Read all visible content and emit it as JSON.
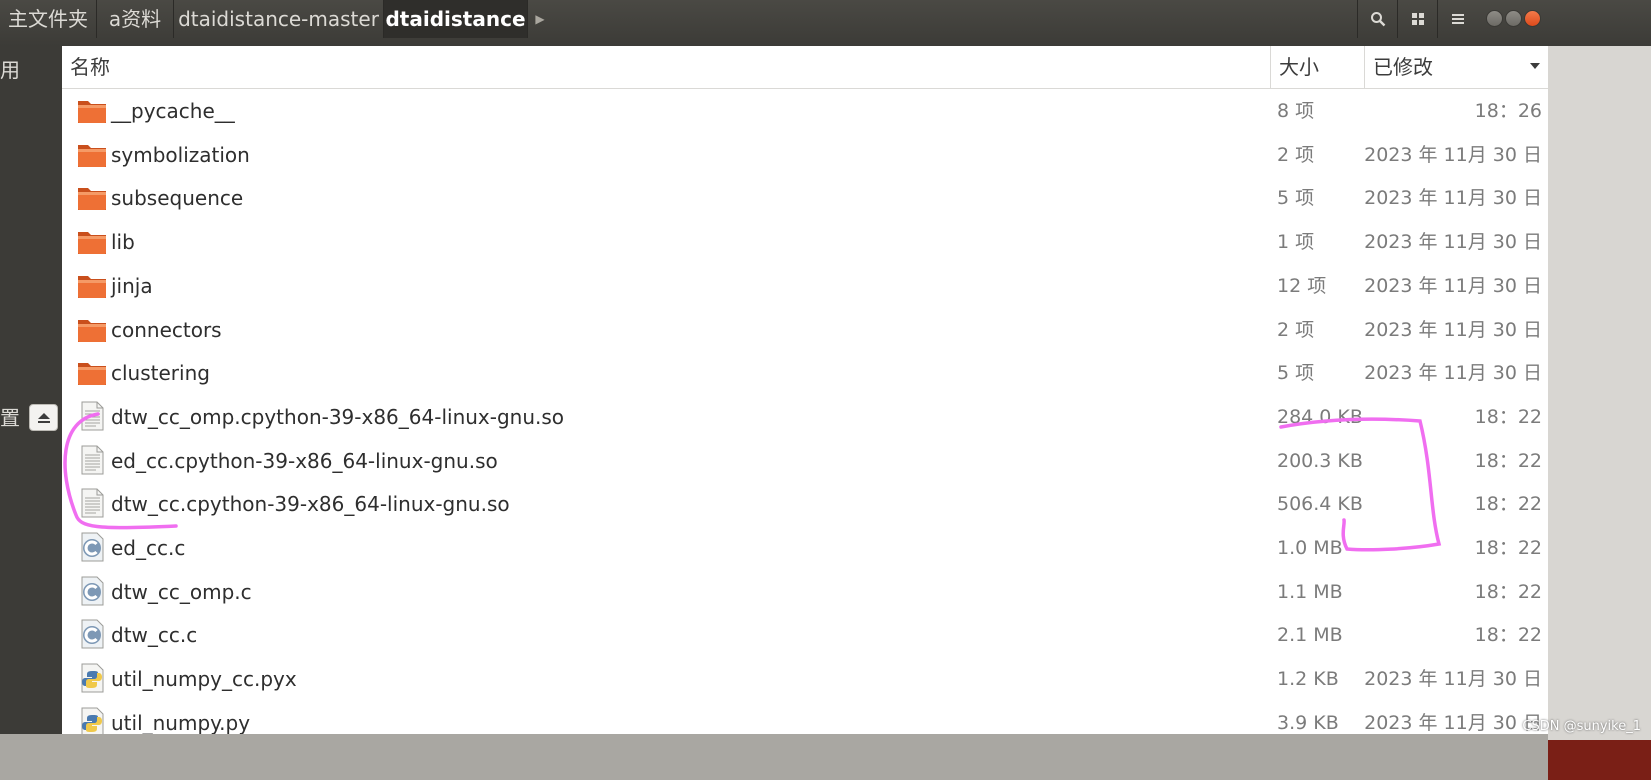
{
  "breadcrumbs": [
    "主文件夹",
    "a资料",
    "dtaidistance-master",
    "dtaidistance"
  ],
  "toolbar": {
    "search_icon": "search-icon",
    "view_icon": "grid-view-icon",
    "menu_icon": "hamburger-menu-icon"
  },
  "sidebar": {
    "partial_label_1": "用",
    "partial_label_2": "置",
    "eject_icon": "eject-icon"
  },
  "columns": {
    "name": "名称",
    "size": "大小",
    "modified": "已修改",
    "sort_icon": "sort-descending-icon"
  },
  "files": [
    {
      "name": "__pycache__",
      "size": "8 项",
      "modified": "18：26",
      "type": "folder"
    },
    {
      "name": "symbolization",
      "size": "2 项",
      "modified": "2023 年 11月 30 日",
      "type": "folder"
    },
    {
      "name": "subsequence",
      "size": "5 项",
      "modified": "2023 年 11月 30 日",
      "type": "folder"
    },
    {
      "name": "lib",
      "size": "1 项",
      "modified": "2023 年 11月 30 日",
      "type": "folder"
    },
    {
      "name": "jinja",
      "size": "12 项",
      "modified": "2023 年 11月 30 日",
      "type": "folder"
    },
    {
      "name": "connectors",
      "size": "2 项",
      "modified": "2023 年 11月 30 日",
      "type": "folder"
    },
    {
      "name": "clustering",
      "size": "5 项",
      "modified": "2023 年 11月 30 日",
      "type": "folder"
    },
    {
      "name": "dtw_cc_omp.cpython-39-x86_64-linux-gnu.so",
      "size": "284.0 KB",
      "modified": "18：22",
      "type": "binary"
    },
    {
      "name": "ed_cc.cpython-39-x86_64-linux-gnu.so",
      "size": "200.3 KB",
      "modified": "18：22",
      "type": "binary"
    },
    {
      "name": "dtw_cc.cpython-39-x86_64-linux-gnu.so",
      "size": "506.4 KB",
      "modified": "18：22",
      "type": "binary"
    },
    {
      "name": "ed_cc.c",
      "size": "1.0 MB",
      "modified": "18：22",
      "type": "c-source"
    },
    {
      "name": "dtw_cc_omp.c",
      "size": "1.1 MB",
      "modified": "18：22",
      "type": "c-source"
    },
    {
      "name": "dtw_cc.c",
      "size": "2.1 MB",
      "modified": "18：22",
      "type": "c-source"
    },
    {
      "name": "util_numpy_cc.pyx",
      "size": "1.2 KB",
      "modified": "2023 年 11月 30 日",
      "type": "python"
    },
    {
      "name": "util_numpy.py",
      "size": "3.9 KB",
      "modified": "2023 年 11月 30 日",
      "type": "python"
    }
  ],
  "watermark": "CSDN @sunyike_1",
  "colors": {
    "folder": "#e8662a",
    "annotation": "#f06ef0",
    "active_crumb": "#2f2e2b",
    "close_button": "#e4552a"
  }
}
